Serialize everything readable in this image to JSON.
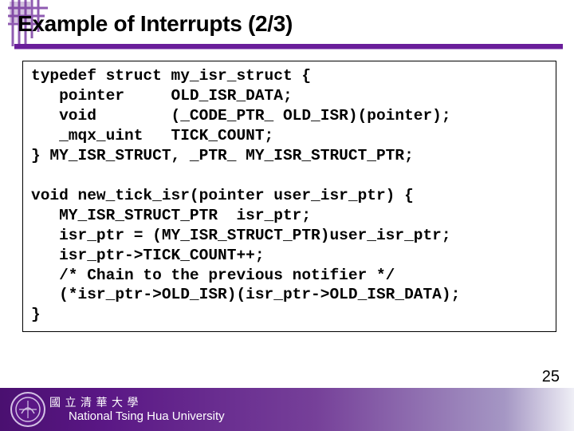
{
  "slide": {
    "title": "Example of Interrupts (2/3)",
    "code": "typedef struct my_isr_struct {\n   pointer     OLD_ISR_DATA;\n   void        (_CODE_PTR_ OLD_ISR)(pointer);\n   _mqx_uint   TICK_COUNT;\n} MY_ISR_STRUCT, _PTR_ MY_ISR_STRUCT_PTR;\n\nvoid new_tick_isr(pointer user_isr_ptr) {\n   MY_ISR_STRUCT_PTR  isr_ptr;\n   isr_ptr = (MY_ISR_STRUCT_PTR)user_isr_ptr;\n   isr_ptr->TICK_COUNT++;\n   /* Chain to the previous notifier */\n   (*isr_ptr->OLD_ISR)(isr_ptr->OLD_ISR_DATA);\n}",
    "page_number": "25",
    "footer": {
      "university_en": "National Tsing Hua University",
      "university_banner": "國 立 清 華 大 學"
    }
  },
  "colors": {
    "accent": "#6a1e9a",
    "footer_start": "#4a1070",
    "footer_end": "#efeff6"
  }
}
